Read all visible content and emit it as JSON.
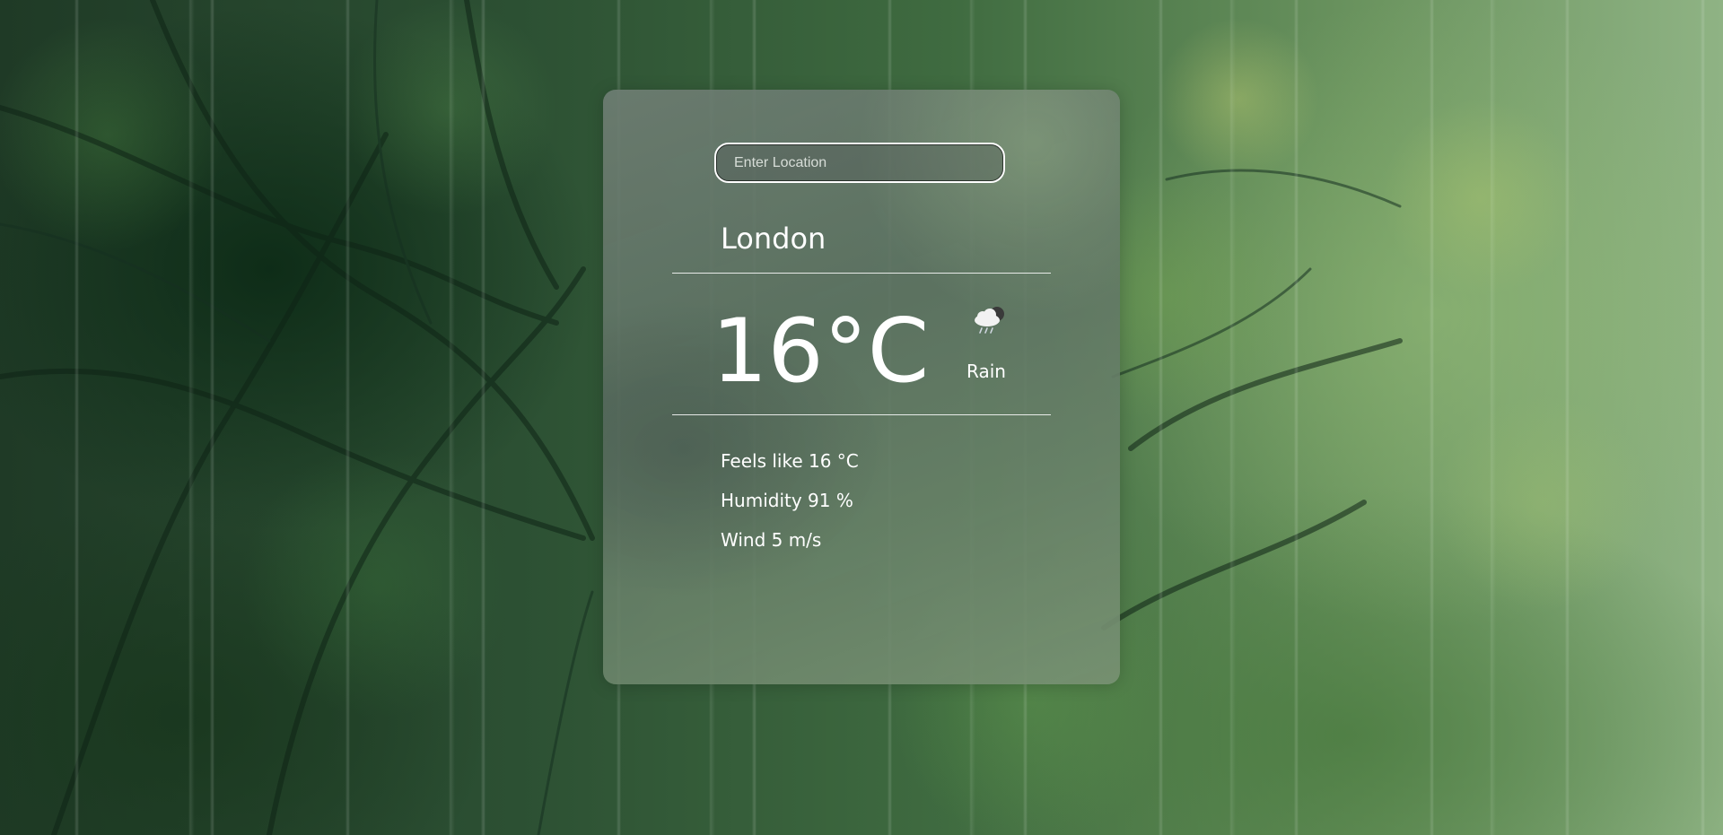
{
  "search": {
    "placeholder": "Enter Location"
  },
  "weather": {
    "city": "London",
    "temperature": "16°C",
    "condition": "Rain",
    "condition_icon": "rain-cloud-icon"
  },
  "details": {
    "feels_like": "Feels like 16 °C",
    "humidity": "Humidity 91 %",
    "wind": "Wind 5 m/s"
  }
}
